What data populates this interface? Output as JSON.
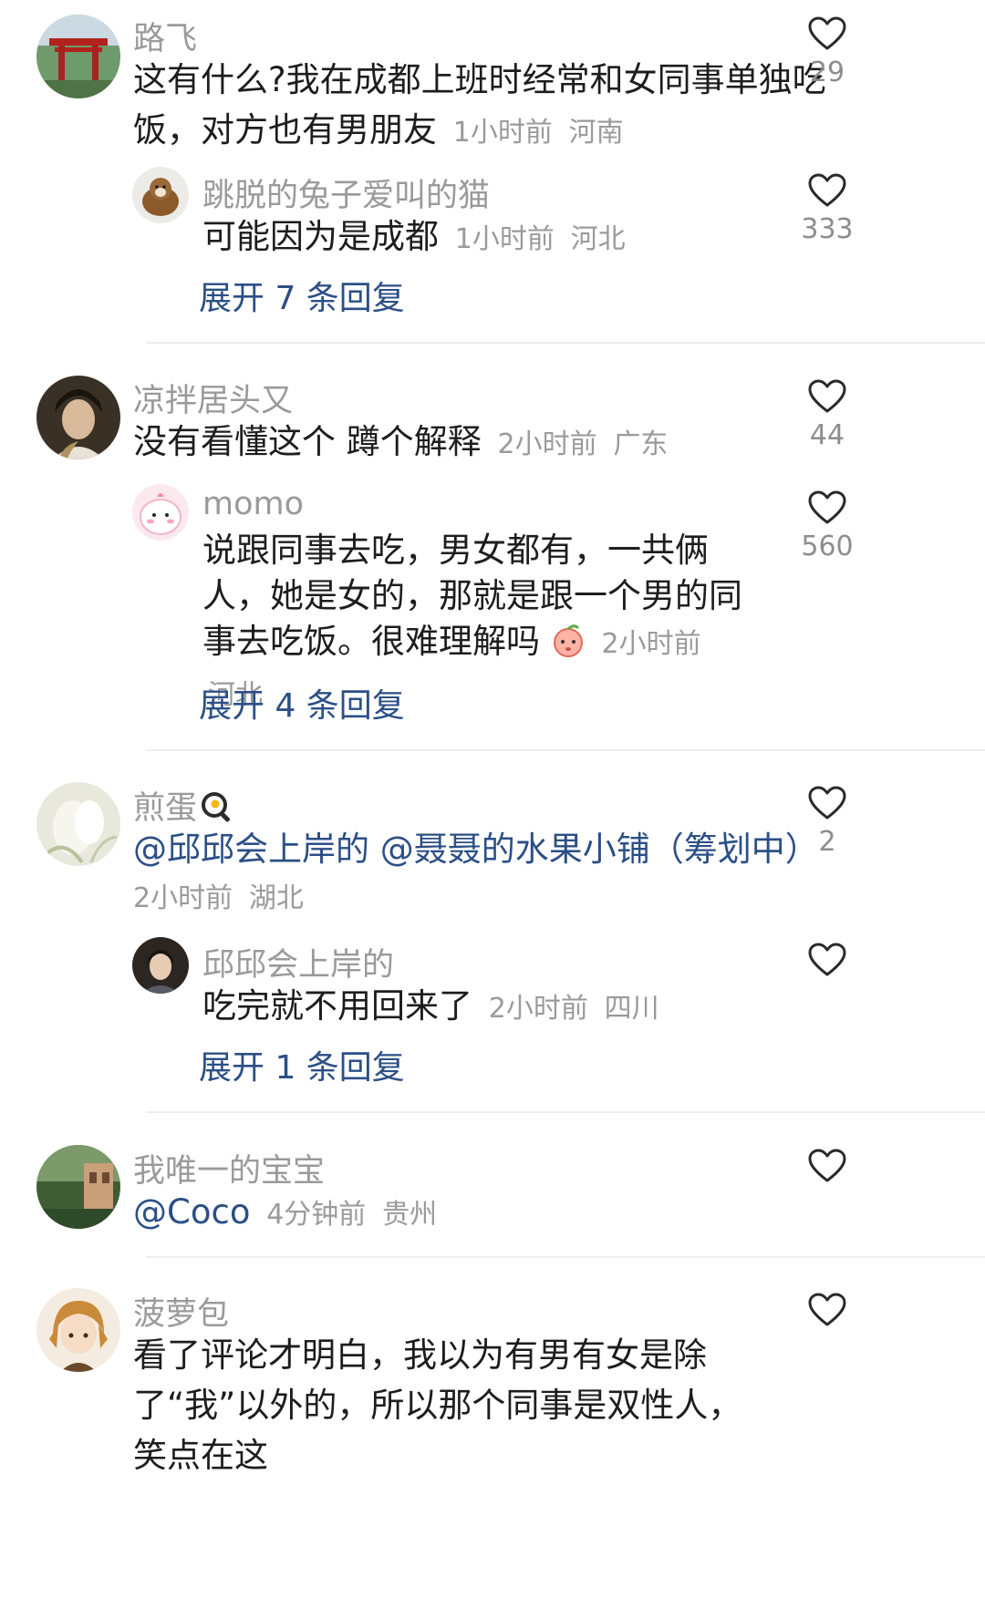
{
  "comments": [
    {
      "username": "路飞",
      "text": "这有什么?我在成都上班时经常和女同事单独吃饭，对方也有男朋友",
      "time": "1小时前",
      "location": "河南",
      "likes": "29",
      "reply": {
        "username": "跳脱的兔子爱叫的猫",
        "text": "可能因为是成都",
        "time": "1小时前",
        "location": "河北",
        "likes": "333"
      },
      "expand_label": "展开 7 条回复"
    },
    {
      "username": "凉拌居头又",
      "text": "没有看懂这个 蹲个解释",
      "time": "2小时前",
      "location": "广东",
      "likes": "44",
      "reply": {
        "username": "momo",
        "text": "说跟同事去吃，男女都有，一共俩人，她是女的，那就是跟一个男的同事去吃饭。很难理解吗",
        "emoji": "peach-face-emoji",
        "time": "2小时前",
        "location": "河北",
        "likes": "560"
      },
      "expand_label": "展开 4 条回复"
    },
    {
      "username": "煎蛋",
      "username_emoji": "frying-pan-egg-emoji",
      "mention1": "@邱邱会上岸的",
      "mention2": "@聂聂的水果小铺（筹划中）",
      "time": "2小时前",
      "location": "湖北",
      "likes": "2",
      "reply": {
        "username": "邱邱会上岸的",
        "text": "吃完就不用回来了",
        "time": "2小时前",
        "location": "四川",
        "likes": ""
      },
      "expand_label": "展开 1 条回复"
    },
    {
      "username": "我唯一的宝宝",
      "mention": "@Coco",
      "time": "4分钟前",
      "location": "贵州",
      "likes": ""
    },
    {
      "username": "菠萝包",
      "text": "看了评论才明白，我以为有男有女是除了“我”以外的，所以那个同事是双性人，笑点在这",
      "time": "",
      "location": "",
      "likes": ""
    }
  ],
  "icons": {
    "like": "heart-outline-icon"
  },
  "colors": {
    "mention": "#2b4f86",
    "meta": "#9a9a9a",
    "text": "#1d1d1d"
  }
}
